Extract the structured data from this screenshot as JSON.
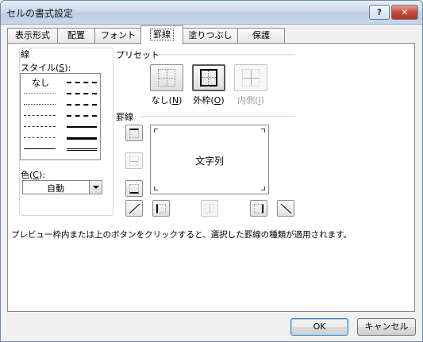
{
  "window": {
    "title": "セルの書式設定",
    "help_label": "?",
    "close_label": "✕"
  },
  "tabs": [
    {
      "label": "表示形式",
      "active": false
    },
    {
      "label": "配置",
      "active": false
    },
    {
      "label": "フォント",
      "active": false
    },
    {
      "label": "罫線",
      "active": true
    },
    {
      "label": "塗りつぶし",
      "active": false
    },
    {
      "label": "保護",
      "active": false
    }
  ],
  "line_group": {
    "title": "線",
    "style_label": "スタイル(",
    "style_key": "S",
    "style_label_end": "):",
    "none_label": "なし",
    "color_label": "色(",
    "color_key": "C",
    "color_label_end": "):",
    "color_value": "自動"
  },
  "presets": {
    "title": "プリセット",
    "items": [
      {
        "label": "なし(",
        "key": "N",
        "end": ")",
        "icon": "preset-none-icon",
        "enabled": true
      },
      {
        "label": "外枠(",
        "key": "O",
        "end": ")",
        "icon": "preset-outline-icon",
        "enabled": true
      },
      {
        "label": "内側(",
        "key": "I",
        "end": ")",
        "icon": "preset-inside-icon",
        "enabled": false
      }
    ]
  },
  "border": {
    "title": "罫線",
    "preview_text": "文字列",
    "buttons": [
      {
        "name": "top-border-button",
        "icon": "top-border-icon",
        "enabled": true
      },
      {
        "name": "inside-horizontal-border-button",
        "icon": "inside-horizontal-border-icon",
        "enabled": false
      },
      {
        "name": "bottom-border-button",
        "icon": "bottom-border-icon",
        "enabled": true
      },
      {
        "name": "diagonal-up-border-button",
        "icon": "diagonal-up-border-icon",
        "enabled": true
      },
      {
        "name": "left-border-button",
        "icon": "left-border-icon",
        "enabled": true
      },
      {
        "name": "inside-vertical-border-button",
        "icon": "inside-vertical-border-icon",
        "enabled": false
      },
      {
        "name": "right-border-button",
        "icon": "right-border-icon",
        "enabled": true
      },
      {
        "name": "diagonal-down-border-button",
        "icon": "diagonal-down-border-icon",
        "enabled": true
      }
    ]
  },
  "description": "プレビュー枠内または上のボタンをクリックすると、選択した罫線の種類が適用されます。",
  "footer": {
    "ok_label": "OK",
    "cancel_label": "キャンセル"
  },
  "colors": {
    "title_bar": "#c9d8e9",
    "close_button": "#c8493a",
    "panel_bg": "#ffffff",
    "dialog_bg": "#f0f0f0"
  }
}
